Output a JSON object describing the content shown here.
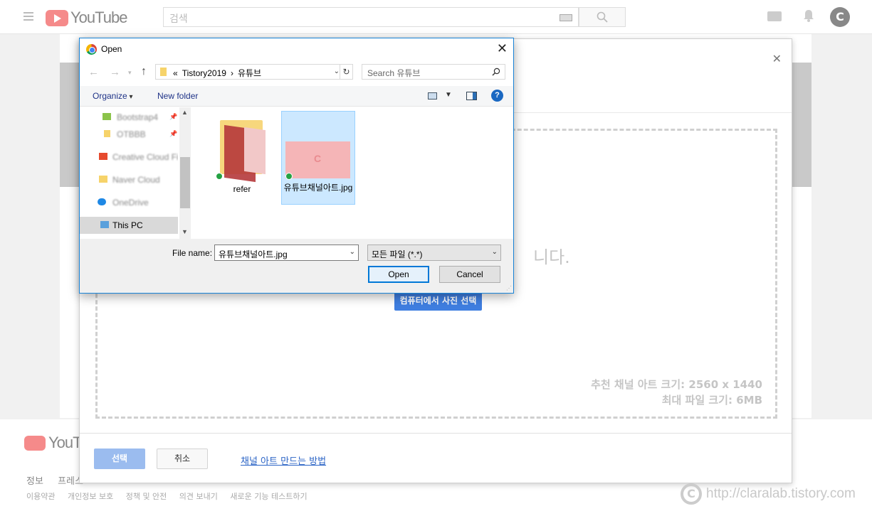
{
  "youtube": {
    "logo_text": "YouTube",
    "search_placeholder": "검색",
    "avatar_letter": "C"
  },
  "footer": {
    "logo_text": "YouTube",
    "links_row1": [
      "정보",
      "프레스"
    ],
    "links_row2": [
      "이용약관",
      "개인정보 보호",
      "정책 및 안전",
      "의견 보내기",
      "새로운 기능 테스트하기"
    ]
  },
  "upload_modal": {
    "drop_text": "니다.",
    "pick_button": "컴퓨터에서 사진 선택",
    "recommended_size": "추천 채널 아트 크기: 2560 x 1440",
    "max_file_size": "최대 파일 크기: 6MB",
    "select_button": "선택",
    "cancel_button": "취소",
    "howto_link": "채널 아트 만드는 방법"
  },
  "open_dialog": {
    "title": "Open",
    "breadcrumb": [
      "«",
      "Tistory2019",
      "›",
      "유튜브"
    ],
    "search_placeholder": "Search 유튜브",
    "toolbar": {
      "organize": "Organize",
      "new_folder": "New folder",
      "help": "?"
    },
    "nav_items": [
      {
        "label": "Bootstrap4",
        "blurred": true
      },
      {
        "label": "OTBBB",
        "blurred": true
      },
      {
        "label": "Creative Cloud Fil",
        "blurred": true
      },
      {
        "label": "Naver Cloud",
        "blurred": true
      },
      {
        "label": "OneDrive",
        "blurred": true
      },
      {
        "label": "This PC",
        "blurred": false,
        "selected": true
      }
    ],
    "files": [
      {
        "name": "refer",
        "type": "folder"
      },
      {
        "name": "유튜브채널아트.jpg",
        "type": "image",
        "selected": true
      }
    ],
    "file_name_label": "File name:",
    "file_name_value": "유튜브채널아트.jpg",
    "file_type": "모든 파일 (*.*)",
    "open_button": "Open",
    "cancel_button": "Cancel"
  },
  "watermark": "http://claralab.tistory.com"
}
